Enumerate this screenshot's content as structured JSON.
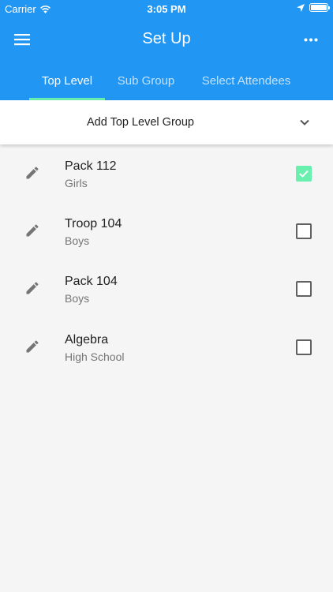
{
  "status_bar": {
    "carrier": "Carrier",
    "time": "3:05 PM"
  },
  "toolbar": {
    "title": "Set Up",
    "menu_icon": "hamburger-menu-icon",
    "more_icon": "more-horizontal-icon"
  },
  "tabs": [
    {
      "label": "Top Level",
      "active": true
    },
    {
      "label": "Sub Group",
      "active": false
    },
    {
      "label": "Select Attendees",
      "active": false
    }
  ],
  "dropdown": {
    "label": "Add Top Level Group",
    "icon": "chevron-down-icon"
  },
  "groups": [
    {
      "name": "Pack 112",
      "subtitle": "Girls",
      "checked": true
    },
    {
      "name": "Troop 104",
      "subtitle": "Boys",
      "checked": false
    },
    {
      "name": "Pack 104",
      "subtitle": "Boys",
      "checked": false
    },
    {
      "name": "Algebra",
      "subtitle": "High School",
      "checked": false
    }
  ],
  "colors": {
    "primary": "#2196f3",
    "accent": "#69f0ae",
    "background": "#f5f5f5"
  }
}
